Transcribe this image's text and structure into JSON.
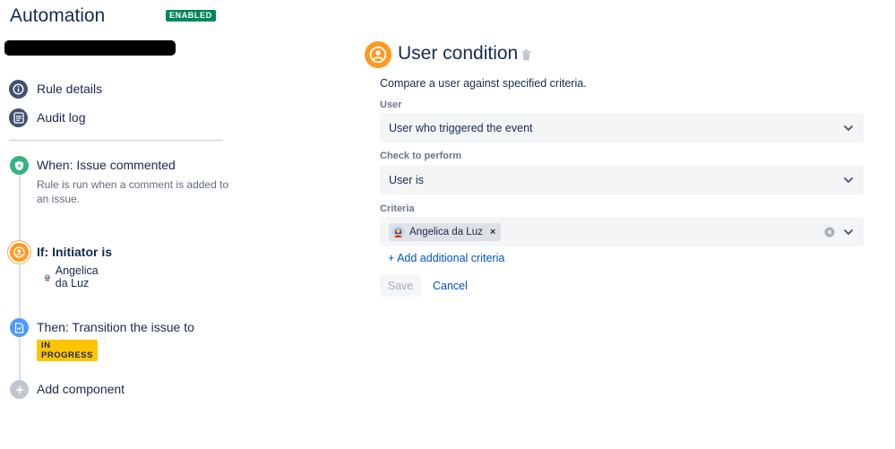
{
  "app": {
    "title": "Automation",
    "status_badge": "ENABLED"
  },
  "nav": {
    "rule_details": "Rule details",
    "audit_log": "Audit log"
  },
  "steps": {
    "trigger": {
      "title": "When: Issue commented",
      "description": "Rule is run when a comment is added to an issue."
    },
    "condition": {
      "prefix": "If: ",
      "title": "Initiator is",
      "user": "Angelica da Luz"
    },
    "action": {
      "title": "Then: Transition the issue to",
      "status": "IN PROGRESS"
    },
    "add": {
      "label": "Add component"
    }
  },
  "panel": {
    "title": "User condition",
    "description": "Compare a user against specified criteria.",
    "user_label": "User",
    "user_value": "User who triggered the event",
    "check_label": "Check to perform",
    "check_value": "User is",
    "criteria_label": "Criteria",
    "criteria_tag": "Angelica da Luz",
    "criteria_tag_remove": "×",
    "add_criteria": "+ Add additional criteria",
    "save": "Save",
    "cancel": "Cancel"
  },
  "colors": {
    "enabled": "#00875a",
    "trigger": "#36b37e",
    "condition": "#ff991f",
    "action": "#4c9aff",
    "lozenge": "#ffc400",
    "link": "#0052cc"
  },
  "icons": {
    "rule_details": "info-icon",
    "audit_log": "list-icon",
    "trigger": "shield-icon",
    "condition": "user-icon",
    "action": "document-icon",
    "add": "plus-icon"
  }
}
